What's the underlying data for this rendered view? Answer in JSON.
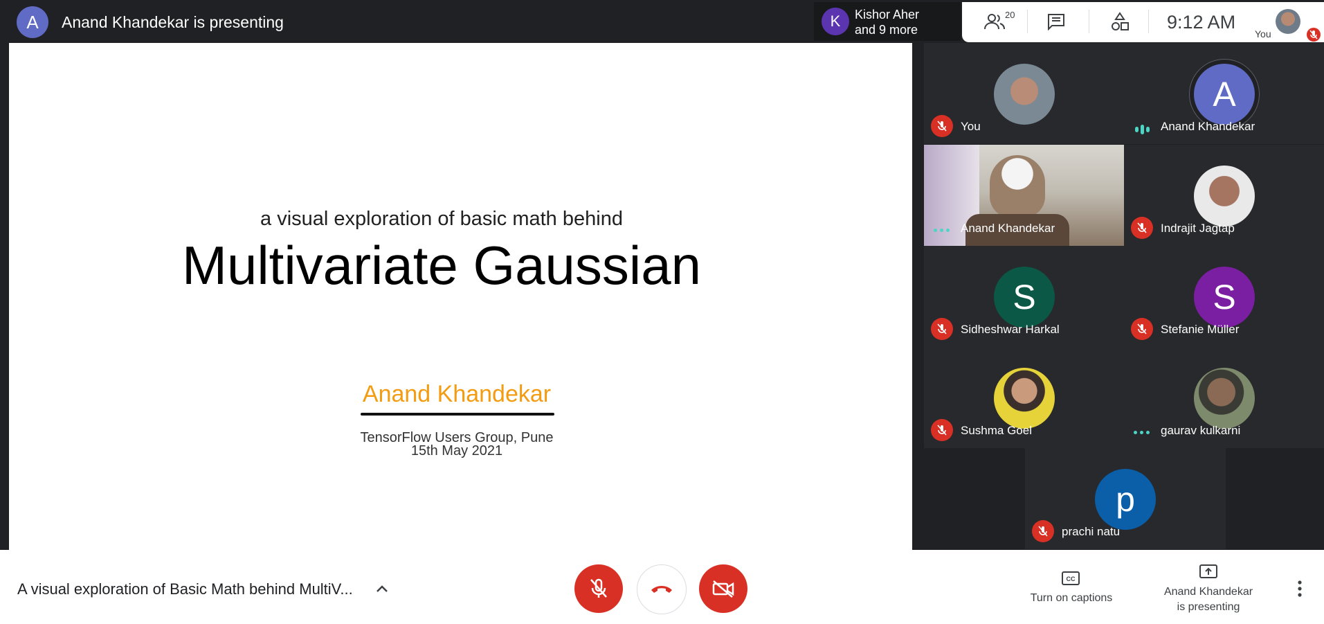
{
  "top_bar": {
    "presenter_avatar": "A",
    "presenting_text": "Anand Khandekar is presenting",
    "others_avatar": "K",
    "others_line1": "Kishor Aher",
    "others_line2": "and 9 more",
    "people_count": "20",
    "clock": "9:12  AM",
    "self_label": "You",
    "icons": [
      "people-icon",
      "chat-icon",
      "activities-icon"
    ]
  },
  "slide": {
    "pre_title": "a visual exploration of basic math behind",
    "title": "Multivariate Gaussian",
    "author": "Anand Khandekar",
    "org": "TensorFlow Users Group, Pune",
    "date": "15th May 2021"
  },
  "participants": [
    {
      "name": "You",
      "type": "photo",
      "status": "muted"
    },
    {
      "name": "Anand Khandekar",
      "type": "avatar",
      "letter": "A",
      "color": "#5f6bc4",
      "status": "speaking"
    },
    {
      "name": "Anand Khandekar",
      "type": "video",
      "status": "dots"
    },
    {
      "name": "Indrajit Jagtap",
      "type": "photo",
      "status": "muted"
    },
    {
      "name": "Sidheshwar Harkal",
      "type": "avatar",
      "letter": "S",
      "color": "#0b5847",
      "status": "muted"
    },
    {
      "name": "Stefanie Müller",
      "type": "avatar",
      "letter": "S",
      "color": "#7b1fa2",
      "status": "muted"
    },
    {
      "name": "Sushma Goel",
      "type": "photo",
      "status": "muted"
    },
    {
      "name": "gaurav kulkarni",
      "type": "photo",
      "status": "dots"
    },
    {
      "name": "prachi natu",
      "type": "avatar",
      "letter": "p",
      "color": "#0b5ea8",
      "status": "muted"
    }
  ],
  "bottom_bar": {
    "meeting_title": "A visual exploration of Basic Math behind MultiV...",
    "captions_label": "Turn on captions",
    "present_label_line1": "Anand Khandekar",
    "present_label_line2": "is presenting",
    "colors": {
      "danger": "#d93025",
      "accent_speaking": "#4cd5c5"
    }
  }
}
